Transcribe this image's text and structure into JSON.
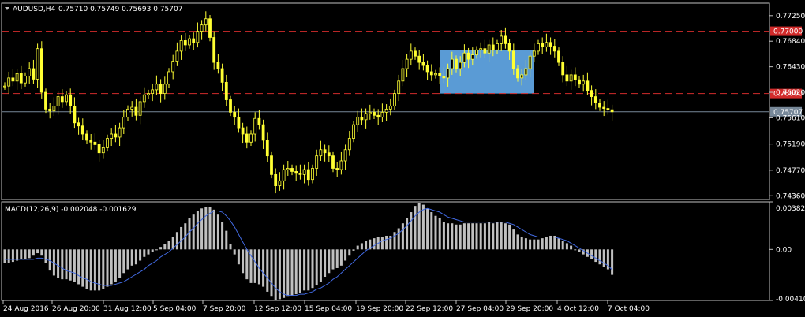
{
  "header": {
    "symbol_label": "AUDUSD,H4",
    "ohlc": "0.75710 0.75749 0.75693 0.75707"
  },
  "macd_header": {
    "label": "MACD(12,26,9) -0.002048 -0.001629"
  },
  "colors": {
    "background": "#000000",
    "candle": "#ffff33",
    "macd_hist": "#c0c0c0",
    "signal": "#4169e1",
    "level_line": "#d22b2b",
    "price_line": "#778899",
    "zone": "#5a9bd5",
    "axis_text": "#ffffff"
  },
  "chart_data": [
    {
      "type": "candlestick",
      "title": "AUDUSD,H4",
      "ylim": [
        0.743,
        0.7745
      ],
      "y_ticks": [
        "0.77250",
        "0.76840",
        "0.76430",
        "0.76020",
        "0.75610",
        "0.75190",
        "0.74770",
        "0.74360"
      ],
      "x_ticks": [
        "24 Aug 2016",
        "26 Aug 20:00",
        "31 Aug 12:00",
        "5 Sep 04:00",
        "7 Sep 20:00",
        "12 Sep 12:00",
        "15 Sep 04:00",
        "19 Sep 20:00",
        "22 Sep 12:00",
        "27 Sep 04:00",
        "29 Sep 20:00",
        "4 Oct 12:00",
        "7 Oct 04:00"
      ],
      "close_path": [
        0.7612,
        0.7625,
        0.762,
        0.7632,
        0.7617,
        0.7628,
        0.764,
        0.7623,
        0.7672,
        0.7602,
        0.7575,
        0.7572,
        0.758,
        0.7595,
        0.7587,
        0.7598,
        0.758,
        0.7553,
        0.7548,
        0.7535,
        0.7525,
        0.7522,
        0.7518,
        0.7505,
        0.7513,
        0.7528,
        0.7535,
        0.753,
        0.7545,
        0.7562,
        0.7575,
        0.7578,
        0.7565,
        0.7587,
        0.7598,
        0.76,
        0.7606,
        0.7615,
        0.76,
        0.7615,
        0.7635,
        0.7652,
        0.7668,
        0.7685,
        0.7678,
        0.7688,
        0.7682,
        0.77,
        0.771,
        0.772,
        0.769,
        0.765,
        0.764,
        0.7618,
        0.759,
        0.757,
        0.7562,
        0.7545,
        0.7535,
        0.7522,
        0.7535,
        0.756,
        0.755,
        0.7525,
        0.75,
        0.747,
        0.7452,
        0.746,
        0.7478,
        0.748,
        0.7475,
        0.7472,
        0.747,
        0.7478,
        0.7462,
        0.748,
        0.75,
        0.751,
        0.7505,
        0.75,
        0.748,
        0.7478,
        0.7492,
        0.751,
        0.7528,
        0.755,
        0.7562,
        0.7558,
        0.7568,
        0.757,
        0.7565,
        0.7562,
        0.757,
        0.7575,
        0.758,
        0.76,
        0.762,
        0.764,
        0.7655,
        0.7668,
        0.766,
        0.765,
        0.7645,
        0.7635,
        0.763,
        0.7632,
        0.7628,
        0.7625,
        0.764,
        0.7655,
        0.764,
        0.765,
        0.7665,
        0.7655,
        0.7662,
        0.767,
        0.7672,
        0.7665,
        0.7678,
        0.767,
        0.768,
        0.7692,
        0.768,
        0.7668,
        0.764,
        0.7625,
        0.763,
        0.764,
        0.766,
        0.7668,
        0.768,
        0.7675,
        0.7682,
        0.7676,
        0.7668,
        0.765,
        0.763,
        0.762,
        0.763,
        0.7622,
        0.7615,
        0.762,
        0.7605,
        0.7595,
        0.7585,
        0.7578,
        0.7576,
        0.7574,
        0.75707
      ],
      "price_labels": {
        "current": "0.75707",
        "level_upper": "0.77000",
        "level_lower": "0.76000"
      },
      "levels": [
        0.77,
        0.76
      ],
      "current_price": 0.75707,
      "zone": {
        "x_from_index": 106,
        "x_to_index": 129,
        "y_from": 0.76,
        "y_to": 0.767
      }
    },
    {
      "type": "bar",
      "title": "MACD(12,26,9) -0.002048 -0.001629",
      "ylim": [
        -0.004103,
        0.003826
      ],
      "y_ticks": [
        "0.003826",
        "0.00",
        "-0.004103"
      ],
      "series": [
        {
          "name": "MACD",
          "values": [
            -0.0011,
            -0.0011,
            -0.001,
            -0.0009,
            -0.0008,
            -0.0008,
            -0.0007,
            -0.0005,
            -0.0003,
            -0.0005,
            -0.0011,
            -0.0017,
            -0.0021,
            -0.0023,
            -0.0024,
            -0.0024,
            -0.0025,
            -0.0026,
            -0.0028,
            -0.003,
            -0.0032,
            -0.0033,
            -0.0033,
            -0.0033,
            -0.0032,
            -0.003,
            -0.0028,
            -0.0026,
            -0.0023,
            -0.0019,
            -0.0016,
            -0.0013,
            -0.0012,
            -0.0009,
            -0.0006,
            -0.0004,
            -0.0002,
            0.0,
            0.0002,
            0.0004,
            0.0007,
            0.001,
            0.0014,
            0.0018,
            0.0021,
            0.0025,
            0.0028,
            0.0031,
            0.0033,
            0.0034,
            0.0034,
            0.0032,
            0.0028,
            0.0022,
            0.0015,
            0.0004,
            -0.0004,
            -0.0012,
            -0.0019,
            -0.0024,
            -0.0027,
            -0.0027,
            -0.0028,
            -0.003,
            -0.0034,
            -0.0038,
            -0.0041,
            -0.004,
            -0.0039,
            -0.0038,
            -0.0037,
            -0.0036,
            -0.0035,
            -0.0033,
            -0.0033,
            -0.0031,
            -0.0029,
            -0.0026,
            -0.0022,
            -0.0019,
            -0.0016,
            -0.0015,
            -0.0013,
            -0.0009,
            -0.0005,
            -0.0001,
            0.0003,
            0.0005,
            0.0007,
            0.0008,
            0.0009,
            0.001,
            0.001,
            0.0011,
            0.0011,
            0.0014,
            0.0017,
            0.0021,
            0.0025,
            0.003,
            0.0035,
            0.0037,
            0.0036,
            0.0033,
            0.003,
            0.0027,
            0.0025,
            0.0022,
            0.0021,
            0.0021,
            0.002,
            0.002,
            0.0021,
            0.0021,
            0.0021,
            0.0021,
            0.0021,
            0.0021,
            0.0022,
            0.0021,
            0.0022,
            0.0022,
            0.0021,
            0.002,
            0.0016,
            0.0012,
            0.001,
            0.0009,
            0.0008,
            0.0008,
            0.0008,
            0.0009,
            0.001,
            0.0011,
            0.0011,
            0.0009,
            0.0007,
            0.0005,
            0.0003,
            0.0,
            -0.0002,
            -0.0004,
            -0.0006,
            -0.0008,
            -0.001,
            -0.0012,
            -0.0014,
            -0.0016,
            -0.002048
          ]
        },
        {
          "name": "Signal",
          "values": [
            -0.0008,
            -0.0008,
            -0.0008,
            -0.0008,
            -0.0008,
            -0.0008,
            -0.0008,
            -0.0008,
            -0.0007,
            -0.0007,
            -0.0008,
            -0.0009,
            -0.0011,
            -0.0013,
            -0.0015,
            -0.0017,
            -0.0018,
            -0.0019,
            -0.0021,
            -0.0023,
            -0.0024,
            -0.0026,
            -0.0027,
            -0.0028,
            -0.0029,
            -0.0029,
            -0.0029,
            -0.0028,
            -0.0027,
            -0.0026,
            -0.0024,
            -0.0022,
            -0.002,
            -0.0018,
            -0.0016,
            -0.0013,
            -0.0011,
            -0.0009,
            -0.0006,
            -0.0004,
            -0.0002,
            0.0001,
            0.0004,
            0.0007,
            0.001,
            0.0014,
            0.0017,
            0.0021,
            0.0024,
            0.0027,
            0.0029,
            0.0031,
            0.0031,
            0.003,
            0.0027,
            0.0023,
            0.0018,
            0.0012,
            0.0006,
            0.0,
            -0.0005,
            -0.001,
            -0.0015,
            -0.0019,
            -0.0023,
            -0.0027,
            -0.0031,
            -0.0034,
            -0.0036,
            -0.0037,
            -0.0037,
            -0.0037,
            -0.0036,
            -0.0036,
            -0.0035,
            -0.0034,
            -0.0032,
            -0.0031,
            -0.0029,
            -0.0027,
            -0.0024,
            -0.0022,
            -0.0019,
            -0.0016,
            -0.0013,
            -0.001,
            -0.0007,
            -0.0004,
            -0.0001,
            0.0001,
            0.0003,
            0.0005,
            0.0007,
            0.0008,
            0.0009,
            0.0011,
            0.0013,
            0.0016,
            0.0019,
            0.0023,
            0.0027,
            0.003,
            0.0032,
            0.0033,
            0.0032,
            0.0031,
            0.003,
            0.0028,
            0.0026,
            0.0025,
            0.0024,
            0.0023,
            0.0022,
            0.0022,
            0.0022,
            0.0022,
            0.0022,
            0.0022,
            0.0022,
            0.0022,
            0.0022,
            0.0022,
            0.0022,
            0.0021,
            0.002,
            0.0018,
            0.0016,
            0.0014,
            0.0012,
            0.0011,
            0.001,
            0.001,
            0.001,
            0.001,
            0.001,
            0.0009,
            0.0008,
            0.0007,
            0.0005,
            0.0003,
            0.0001,
            -0.0001,
            -0.0003,
            -0.0005,
            -0.0007,
            -0.0009,
            -0.0011,
            -0.0013,
            -0.001629
          ]
        }
      ]
    }
  ]
}
